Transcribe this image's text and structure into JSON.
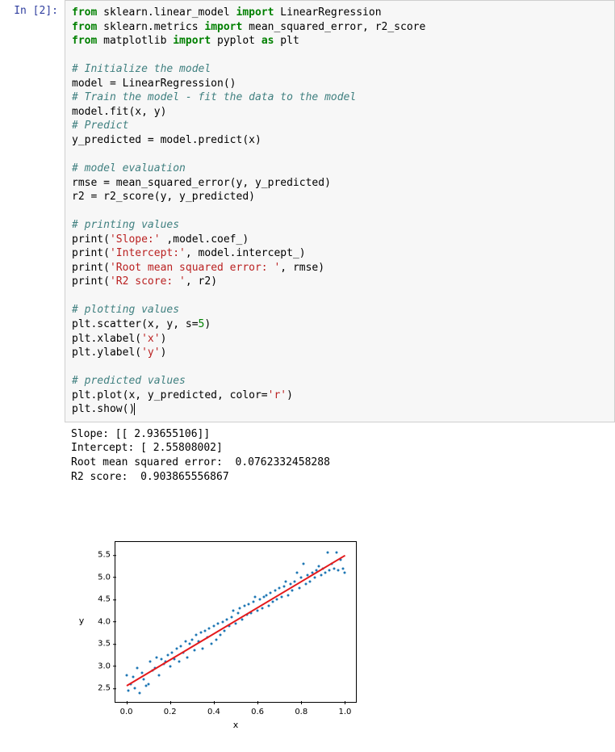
{
  "prompt": {
    "in_label": "In [2]:",
    "out_label": ""
  },
  "code": {
    "l1a": "from",
    "l1b": " sklearn.linear_model ",
    "l1c": "import",
    "l1d": " LinearRegression",
    "l2a": "from",
    "l2b": " sklearn.metrics ",
    "l2c": "import",
    "l2d": " mean_squared_error, r2_score",
    "l3a": "from",
    "l3b": " matplotlib ",
    "l3c": "import",
    "l3d": " pyplot ",
    "l3e": "as",
    "l3f": " plt",
    "c1": "# Initialize the model",
    "l4": "model = LinearRegression()",
    "c2": "# Train the model - fit the data to the model",
    "l5": "model.fit(x, y)",
    "c3": "# Predict",
    "l6": "y_predicted = model.predict(x)",
    "c4": "# model evaluation",
    "l7": "rmse = mean_squared_error(y, y_predicted)",
    "l8": "r2 = r2_score(y, y_predicted)",
    "c5": "# printing values",
    "p1a": "print(",
    "p1s": "'Slope:'",
    "p1b": " ,model.coef_)",
    "p2a": "print(",
    "p2s": "'Intercept:'",
    "p2b": ", model.intercept_)",
    "p3a": "print(",
    "p3s": "'Root mean squared error: '",
    "p3b": ", rmse)",
    "p4a": "print(",
    "p4s": "'R2 score: '",
    "p4b": ", r2)",
    "c6": "# plotting values",
    "l9a": "plt.scatter(x, y, s=",
    "l9n": "5",
    "l9b": ")",
    "l10a": "plt.xlabel(",
    "l10s": "'x'",
    "l10b": ")",
    "l11a": "plt.ylabel(",
    "l11s": "'y'",
    "l11b": ")",
    "c7": "# predicted values",
    "l12a": "plt.plot(x, y_predicted, color=",
    "l12s": "'r'",
    "l12b": ")",
    "l13": "plt.show()"
  },
  "output": {
    "line1": "Slope: [[ 2.93655106]]",
    "line2": "Intercept: [ 2.55808002]",
    "line3": "Root mean squared error:  0.0762332458288",
    "line4": "R2 score:  0.903865556867"
  },
  "chart_data": {
    "type": "scatter+line",
    "xlabel": "x",
    "ylabel": "y",
    "xlim": [
      -0.05,
      1.05
    ],
    "ylim": [
      2.2,
      5.8
    ],
    "x_ticks": [
      0.0,
      0.2,
      0.4,
      0.6,
      0.8,
      1.0
    ],
    "x_tick_labels": [
      "0.0",
      "0.2",
      "0.4",
      "0.6",
      "0.8",
      "1.0"
    ],
    "y_ticks": [
      2.5,
      3.0,
      3.5,
      4.0,
      4.5,
      5.0,
      5.5
    ],
    "y_tick_labels": [
      "2.5",
      "3.0",
      "3.5",
      "4.0",
      "4.5",
      "5.0",
      "5.5"
    ],
    "regression_line": {
      "slope": 2.93655106,
      "intercept": 2.55808002,
      "x0": 0.0,
      "x1": 1.0
    },
    "scatter": {
      "x": [
        0.0,
        0.01,
        0.02,
        0.03,
        0.04,
        0.05,
        0.06,
        0.07,
        0.08,
        0.09,
        0.1,
        0.11,
        0.12,
        0.13,
        0.14,
        0.15,
        0.16,
        0.17,
        0.18,
        0.19,
        0.2,
        0.21,
        0.22,
        0.23,
        0.24,
        0.25,
        0.26,
        0.27,
        0.28,
        0.29,
        0.3,
        0.31,
        0.32,
        0.33,
        0.34,
        0.35,
        0.36,
        0.37,
        0.38,
        0.39,
        0.4,
        0.41,
        0.42,
        0.43,
        0.44,
        0.45,
        0.46,
        0.47,
        0.48,
        0.49,
        0.5,
        0.51,
        0.52,
        0.53,
        0.54,
        0.55,
        0.56,
        0.57,
        0.58,
        0.59,
        0.6,
        0.61,
        0.62,
        0.63,
        0.64,
        0.65,
        0.66,
        0.67,
        0.68,
        0.69,
        0.7,
        0.71,
        0.72,
        0.73,
        0.74,
        0.75,
        0.76,
        0.77,
        0.78,
        0.79,
        0.8,
        0.81,
        0.82,
        0.83,
        0.84,
        0.85,
        0.86,
        0.87,
        0.88,
        0.89,
        0.9,
        0.91,
        0.92,
        0.93,
        0.94,
        0.95,
        0.96,
        0.97,
        0.98,
        0.99,
        1.0
      ],
      "y": [
        2.8,
        2.45,
        2.6,
        2.75,
        2.5,
        2.95,
        2.4,
        2.85,
        2.7,
        2.55,
        2.6,
        3.1,
        2.9,
        2.95,
        3.2,
        2.8,
        3.15,
        3.05,
        3.1,
        3.25,
        3.0,
        3.3,
        3.15,
        3.4,
        3.1,
        3.45,
        3.3,
        3.55,
        3.2,
        3.5,
        3.6,
        3.35,
        3.7,
        3.55,
        3.75,
        3.4,
        3.8,
        3.65,
        3.85,
        3.5,
        3.9,
        3.6,
        3.95,
        3.7,
        4.0,
        3.8,
        4.05,
        3.9,
        4.1,
        4.25,
        3.95,
        4.2,
        4.3,
        4.05,
        4.35,
        4.15,
        4.4,
        4.2,
        4.45,
        4.55,
        4.25,
        4.5,
        4.3,
        4.55,
        4.6,
        4.35,
        4.65,
        4.45,
        4.7,
        4.5,
        4.75,
        4.55,
        4.8,
        4.9,
        4.6,
        4.85,
        4.7,
        4.9,
        5.1,
        4.75,
        5.0,
        5.3,
        4.85,
        5.05,
        4.9,
        5.1,
        5.0,
        5.15,
        5.25,
        5.05,
        5.2,
        5.1,
        5.55,
        5.15,
        5.3,
        5.2,
        5.55,
        5.15,
        5.4,
        5.2,
        5.1
      ]
    }
  }
}
